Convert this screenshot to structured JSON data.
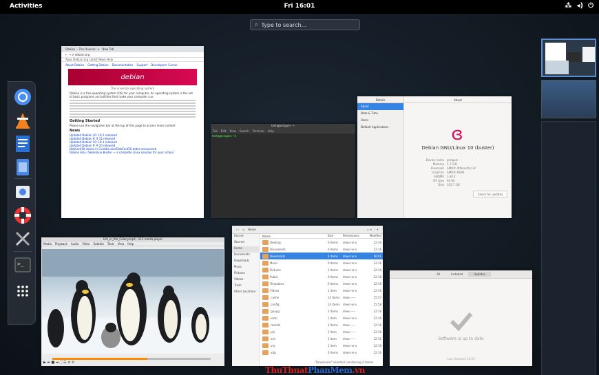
{
  "topbar": {
    "activities": "Activities",
    "clock": "Fri 16:01"
  },
  "search": {
    "placeholder": "Type to search..."
  },
  "dash": {
    "items": [
      "chrome-icon",
      "vlc-icon",
      "writer-icon",
      "text-editor-icon",
      "screenshot-icon",
      "help-icon",
      "settings-tools-icon",
      "terminal-icon",
      "app-grid-icon"
    ]
  },
  "browser": {
    "tab": "Debian -- The Univers- ×",
    "newtab": "New Tab",
    "url": "debian.org",
    "bookmarks": "Apps   Debian.org   Latest News   Help",
    "nav": [
      "About Debian",
      "Getting Debian",
      "Documentation",
      "Support",
      "Developers' Corner"
    ],
    "banner": "debian",
    "banner_sub": "The universal operating system",
    "intro": "Debian is a free operating system (OS) for your computer. An operating system is the set of basic programs and utilities that make your computer run.",
    "getting_started": "Getting Started",
    "gs_text": "Please use the navigation bar at the top of this page to access more content.",
    "news": "News",
    "news_items": [
      "Updated Debian 10: 10.2 released",
      "Updated Debian 9: 9.11 released",
      "Updated Debian 10: 10.1 released",
      "Updated Debian 9: 9.10 released",
      "DebConf19 closes in Curitiba and DebConf20 dates announced",
      "Debian Edu / Skolelinux Buster — a complete Linux solution for your school"
    ]
  },
  "terminal": {
    "title": "test@penguin: ~",
    "menu": [
      "File",
      "Edit",
      "View",
      "Search",
      "Terminal",
      "Help"
    ],
    "prompt": "test@penguin:~$"
  },
  "settings": {
    "side_title": "Details",
    "main_title": "About",
    "side_items": [
      "About",
      "Date & Time",
      "Users",
      "Default Applications"
    ],
    "os_name": "Debian GNU/Linux 10 (buster)",
    "fields": [
      {
        "k": "Device name",
        "v": "penguin"
      },
      {
        "k": "Memory",
        "v": "2.7 GiB"
      },
      {
        "k": "Processor",
        "v": "AMD® Athlon(tm) x2"
      },
      {
        "k": "Graphics",
        "v": "AMD® NV86"
      },
      {
        "k": "GNOME",
        "v": "3.30.2"
      },
      {
        "k": "OS type",
        "v": "64-bit"
      },
      {
        "k": "Disk",
        "v": "103.7 GB"
      }
    ],
    "update_button": "Check for updates"
  },
  "vlc": {
    "title": "Life_in_the_Colony.mp4 - VLC media player",
    "menu": [
      "Media",
      "Playback",
      "Audio",
      "Video",
      "Subtitle",
      "Tools",
      "View",
      "Help"
    ],
    "time_elapsed": "00:13",
    "time_total": "01:21",
    "progress": 0.6
  },
  "files": {
    "path": "Home",
    "sidebar": [
      "Recent",
      "Starred",
      "Home",
      "Documents",
      "Downloads",
      "Music",
      "Pictures",
      "Videos",
      "Trash",
      "Other Locations"
    ],
    "columns": [
      "Name",
      "Size",
      "Permissions",
      "Modified"
    ],
    "rows": [
      {
        "name": "Desktop",
        "size": "0 items",
        "perm": "drwxr-xr-x",
        "mod": "12:16"
      },
      {
        "name": "Documents",
        "size": "0 items",
        "perm": "drwxr-xr-x",
        "mod": "12:16"
      },
      {
        "name": "Downloads",
        "size": "4 items",
        "perm": "drwxr-xr-x",
        "mod": "16:01",
        "sel": true
      },
      {
        "name": "Music",
        "size": "0 items",
        "perm": "drwxr-xr-x",
        "mod": "12:16"
      },
      {
        "name": "Pictures",
        "size": "2 items",
        "perm": "drwxr-xr-x",
        "mod": "12:16"
      },
      {
        "name": "Public",
        "size": "0 items",
        "perm": "drwxr-xr-x",
        "mod": "12:16"
      },
      {
        "name": "Templates",
        "size": "0 items",
        "perm": "drwxr-xr-x",
        "mod": "12:16"
      },
      {
        "name": "Videos",
        "size": "1 item",
        "perm": "drwxr-xr-x",
        "mod": "12:16"
      },
      {
        "name": ".cache",
        "size": "13 items",
        "perm": "drwx------",
        "mod": "15:57"
      },
      {
        "name": ".config",
        "size": "14 items",
        "perm": "drwxr-xr-x",
        "mod": "15:58"
      },
      {
        "name": ".gnupg",
        "size": "2 items",
        "perm": "drwx------",
        "mod": "12:16"
      },
      {
        "name": ".local",
        "size": "1 item",
        "perm": "drwxr-xr-x",
        "mod": "12:16"
      },
      {
        "name": ".mozilla",
        "size": "2 items",
        "perm": "drwx------",
        "mod": "12:16"
      },
      {
        "name": ".pki",
        "size": "1 item",
        "perm": "drwx------",
        "mod": "12:16"
      },
      {
        "name": ".ssh",
        "size": "1 item",
        "perm": "drwx------",
        "mod": "12:16"
      },
      {
        "name": ".vnc",
        "size": "1 item",
        "perm": "drwxr-xr-x",
        "mod": "12:16"
      },
      {
        "name": ".xdg",
        "size": "3 items",
        "perm": "drwxr-xr-x",
        "mod": "12:16"
      }
    ],
    "status": "\"Downloads\" selected (containing 4 items)"
  },
  "software": {
    "tabs": [
      "All",
      "Installed",
      "Updates"
    ],
    "message": "Software is up to date",
    "last_checked": "Last checked: 16:00"
  },
  "watermark": {
    "a": "ThuThuat",
    "b": "PhanMem",
    "c": ".vn"
  }
}
